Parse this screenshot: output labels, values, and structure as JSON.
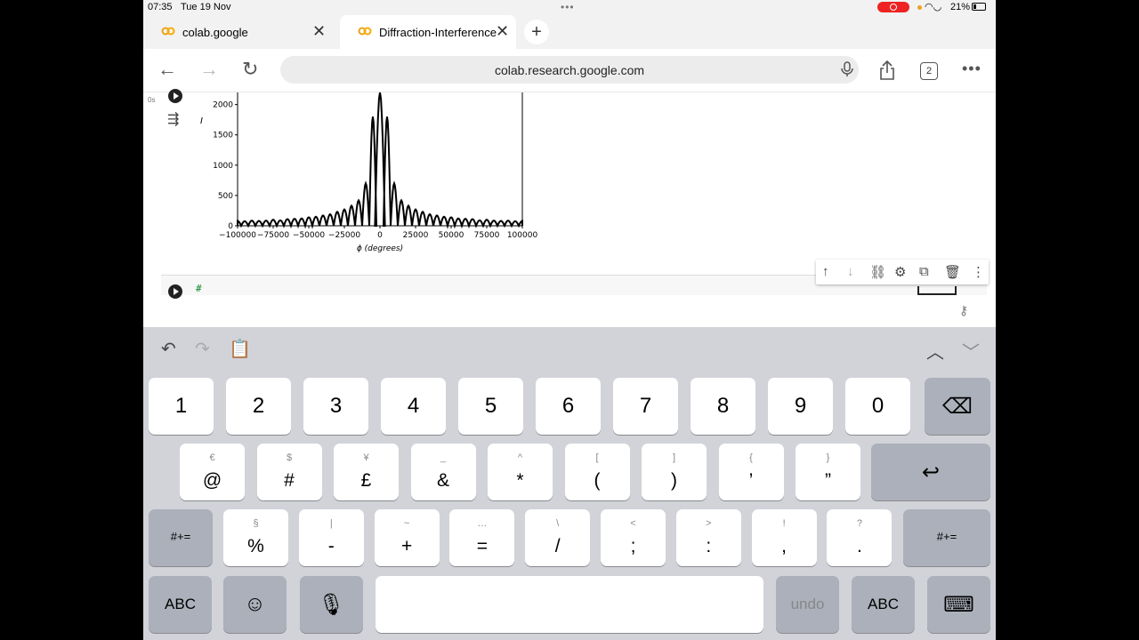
{
  "status": {
    "time": "07:35",
    "date": "Tue 19 Nov",
    "battery": "21%"
  },
  "tabs": [
    {
      "title": "colab.google"
    },
    {
      "title": "Diffraction-Interference"
    }
  ],
  "address": {
    "url": "colab.research.google.com"
  },
  "tab_count": "2",
  "cell1": {
    "exec_time": "0s"
  },
  "cell2": {
    "code": "#"
  },
  "keyboard": {
    "row1": [
      "1",
      "2",
      "3",
      "4",
      "5",
      "6",
      "7",
      "8",
      "9",
      "0"
    ],
    "row2": [
      {
        "top": "€",
        "main": "@"
      },
      {
        "top": "$",
        "main": "#"
      },
      {
        "top": "¥",
        "main": "£"
      },
      {
        "top": "_",
        "main": "&"
      },
      {
        "top": "^",
        "main": "*"
      },
      {
        "top": "[",
        "main": "("
      },
      {
        "top": "]",
        "main": ")"
      },
      {
        "top": "{",
        "main": "’"
      },
      {
        "top": "}",
        "main": "”"
      }
    ],
    "row3": [
      {
        "top": "§",
        "main": "%"
      },
      {
        "top": "|",
        "main": "-"
      },
      {
        "top": "~",
        "main": "+"
      },
      {
        "top": "…",
        "main": "="
      },
      {
        "top": "\\",
        "main": "/"
      },
      {
        "top": "<",
        "main": ";"
      },
      {
        "top": ">",
        "main": ":"
      },
      {
        "top": "!",
        "main": ","
      },
      {
        "top": "?",
        "main": "."
      }
    ],
    "symbol_toggle": "#+=",
    "abc": "ABC",
    "undo": "undo"
  },
  "chart_data": {
    "type": "line",
    "title": "",
    "xlabel": "ϕ (degrees)",
    "ylabel": "I",
    "xlim": [
      -100000,
      100000
    ],
    "ylim": [
      0,
      2200
    ],
    "xticks": [
      "−100000",
      "−75000",
      "−50000",
      "−25000",
      "0",
      "25000",
      "50000",
      "75000",
      "100000"
    ],
    "xtick_values": [
      -100000,
      -75000,
      -50000,
      -25000,
      0,
      25000,
      50000,
      75000,
      100000
    ],
    "yticks": [
      "0",
      "500",
      "1000",
      "1500",
      "2000"
    ],
    "ytick_values": [
      0,
      500,
      1000,
      1500,
      2000
    ],
    "series": [
      {
        "x": [
          -100000,
          -95000,
          -90000,
          -85000,
          -80000,
          -75000,
          -70000,
          -65000,
          -60000,
          -55000,
          -50000,
          -45000,
          -40000,
          -35000,
          -30000,
          -25000,
          -20000,
          -15000,
          -10000,
          -5000,
          0,
          5000,
          10000,
          15000,
          20000,
          25000,
          30000,
          35000,
          40000,
          45000,
          50000,
          55000,
          60000,
          65000,
          70000,
          75000,
          80000,
          85000,
          90000,
          95000,
          100000
        ],
        "peaks": [
          80,
          75,
          85,
          80,
          85,
          100,
          90,
          110,
          115,
          120,
          140,
          150,
          170,
          190,
          230,
          270,
          330,
          420,
          700,
          1800,
          2200,
          1800,
          700,
          420,
          330,
          270,
          230,
          190,
          170,
          150,
          140,
          120,
          115,
          110,
          90,
          100,
          85,
          80,
          85,
          75,
          80
        ]
      }
    ]
  },
  "colors": {
    "link_icon": "#e8a317",
    "accent": "#0a8a2a"
  }
}
